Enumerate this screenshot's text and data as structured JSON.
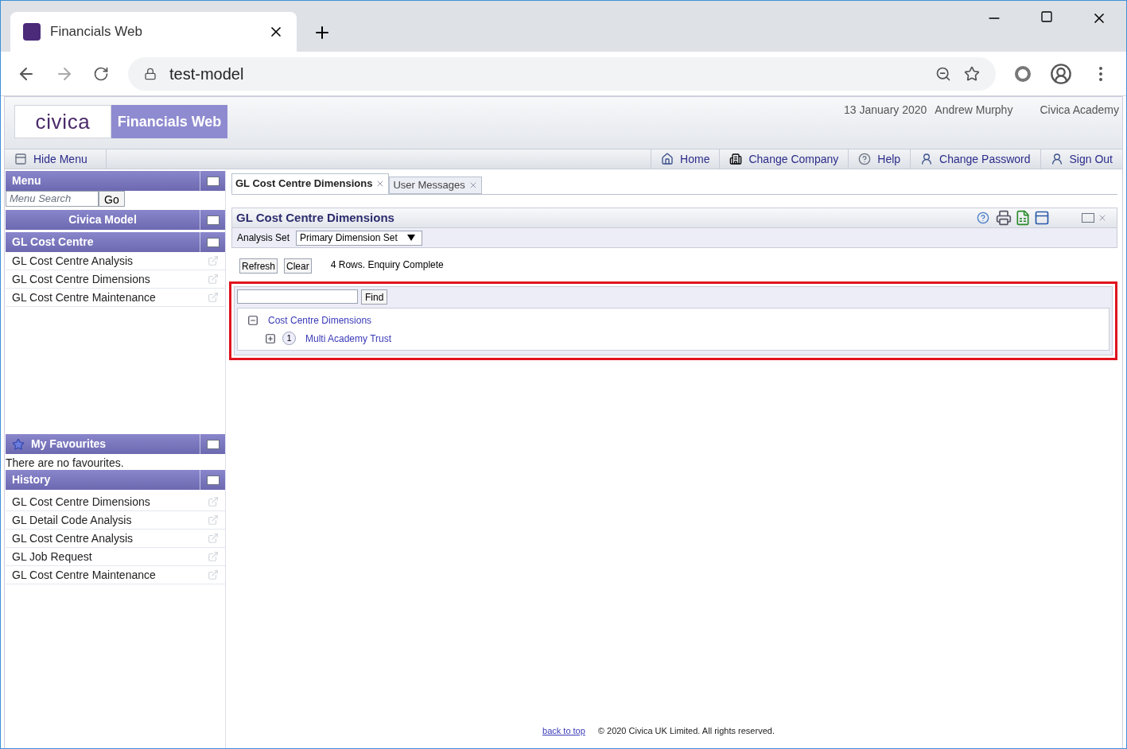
{
  "browser": {
    "tab_title": "Financials Web",
    "url": "test-model"
  },
  "header": {
    "logo": "civica",
    "product": "Financials Web",
    "date": "13 January 2020",
    "user": "Andrew Murphy",
    "organisation": "Civica Academy"
  },
  "toolbar": {
    "hide_menu": "Hide Menu",
    "links": [
      {
        "kind": "home",
        "label": "Home"
      },
      {
        "kind": "company",
        "label": "Change Company"
      },
      {
        "kind": "help",
        "label": "Help"
      },
      {
        "kind": "user",
        "label": "Change Password"
      },
      {
        "kind": "user",
        "label": "Sign Out"
      }
    ]
  },
  "sidebar": {
    "menu_title": "Menu",
    "search": {
      "placeholder": "Menu Search"
    },
    "go": "Go",
    "section": "Civica Model",
    "group": "GL Cost Centre",
    "items": [
      "GL Cost Centre Analysis",
      "GL Cost Centre Dimensions",
      "GL Cost Centre Maintenance"
    ],
    "favourites_title": "My Favourites",
    "favourites_empty": "There are no favourites.",
    "history_title": "History",
    "history": [
      "GL Cost Centre Dimensions",
      "GL Detail Code Analysis",
      "GL Cost Centre Analysis",
      "GL Job Request",
      "GL Cost Centre Maintenance"
    ]
  },
  "tabs": [
    {
      "label": "GL Cost Centre Dimensions",
      "selected": true
    },
    {
      "label": "User Messages",
      "selected": false
    }
  ],
  "panel": {
    "title": "GL Cost Centre Dimensions",
    "analysis_label": "Analysis Set",
    "analysis_value": "Primary Dimension Set",
    "buttons": [
      "Refresh",
      "Clear"
    ],
    "status": "4 Rows. Enquiry Complete",
    "find": "Find",
    "tree": [
      {
        "label": "Cost Centre Dimensions",
        "expanded": true,
        "children": [
          {
            "badge": "1",
            "label": "Multi Academy Trust",
            "expanded": false
          }
        ]
      }
    ]
  },
  "footer": {
    "back_to_top": "back to top",
    "copyright": "© 2020 Civica UK Limited. All rights reserved."
  }
}
